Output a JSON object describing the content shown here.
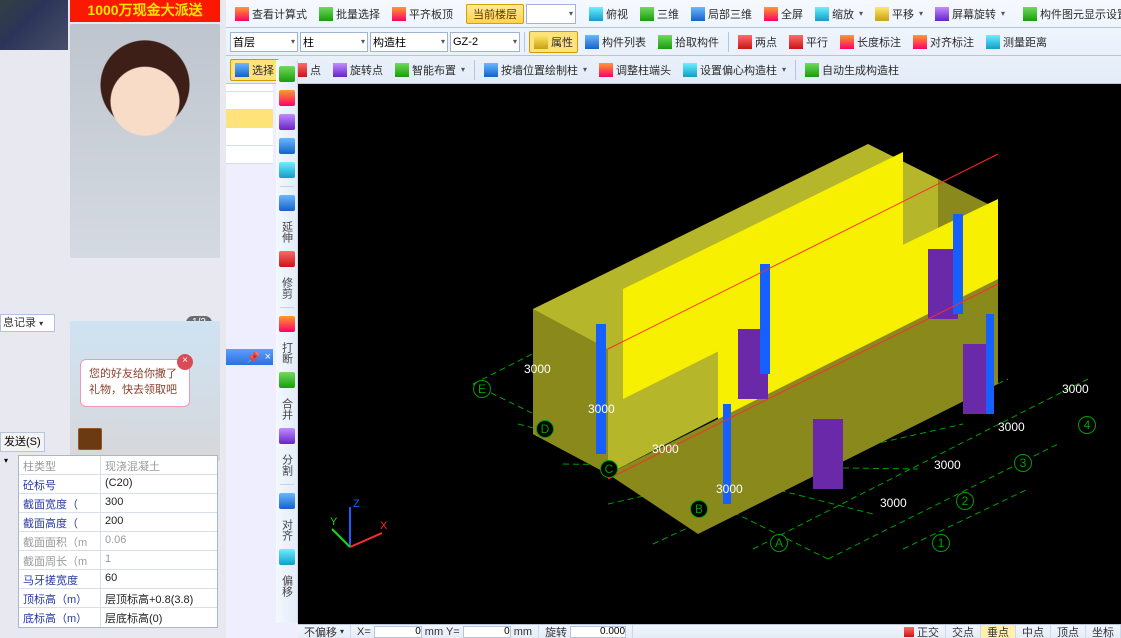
{
  "promo_text": "1000万现金大派送",
  "log_label": "息记录",
  "pager": "1/2",
  "bubble_text": "您的好友给你撒了礼物，快去领取吧",
  "send_label": "发送(S)",
  "props": [
    {
      "k": "柱类型",
      "v": "(C20)",
      "dis": false,
      "id": "row-type-disabled",
      "label_id": "砼标号"
    },
    {
      "k": "截面宽度（",
      "v": "300",
      "dis": false
    },
    {
      "k": "截面高度（",
      "v": "200",
      "dis": false
    },
    {
      "k": "截面面积（m",
      "v": "0.06",
      "dis": true
    },
    {
      "k": "截面周长（m",
      "v": "1",
      "dis": true
    },
    {
      "k": "马牙搓宽度",
      "v": "60",
      "dis": false
    },
    {
      "k": "顶标高（m）",
      "v": "层顶标高+0.8(3.8)",
      "dis": false
    },
    {
      "k": "底标高（m）",
      "v": "层底标高(0)",
      "dis": false
    }
  ],
  "tb1": {
    "items": [
      "查看计算式",
      "批量选择",
      "平齐板顶"
    ],
    "floor_label": "当前楼层",
    "right": [
      "俯视",
      "三维",
      "局部三维",
      "全屏",
      "缩放",
      "平移",
      "屏幕旋转",
      "构件图元显示设置"
    ]
  },
  "tb2": {
    "floor": "首层",
    "col": "柱",
    "subtype": "构造柱",
    "code": "GZ-2",
    "btns": [
      "属性",
      "构件列表",
      "拾取构件"
    ],
    "rbtns": [
      "两点",
      "平行",
      "长度标注",
      "对齐标注",
      "测量距离"
    ]
  },
  "tb3": {
    "sel": "选择",
    "items": [
      "点",
      "旋转点",
      "智能布置",
      "按墙位置绘制柱",
      "调整柱端头",
      "设置偏心构造柱",
      "自动生成构造柱"
    ]
  },
  "vtool": [
    "延伸",
    "修剪",
    "打断",
    "合并",
    "分割",
    "对齐",
    "偏移"
  ],
  "status": {
    "l": [
      "不偏移",
      "X=",
      "0",
      "mm Y=",
      "0",
      "mm",
      "旋转",
      "0.000"
    ],
    "r": [
      "正交",
      "交点",
      "垂点",
      "中点",
      "顶点",
      "坐标"
    ]
  },
  "grid": {
    "rows": [
      "A",
      "B",
      "C",
      "D",
      "E"
    ],
    "cols": [
      "1",
      "2",
      "3",
      "4"
    ],
    "row_dims": [
      "3000",
      "3000",
      "3000",
      "3000"
    ],
    "col_dims": [
      "3000",
      "3000",
      "3000"
    ]
  },
  "axes": {
    "x": "X",
    "y": "Y",
    "z": "Z"
  }
}
